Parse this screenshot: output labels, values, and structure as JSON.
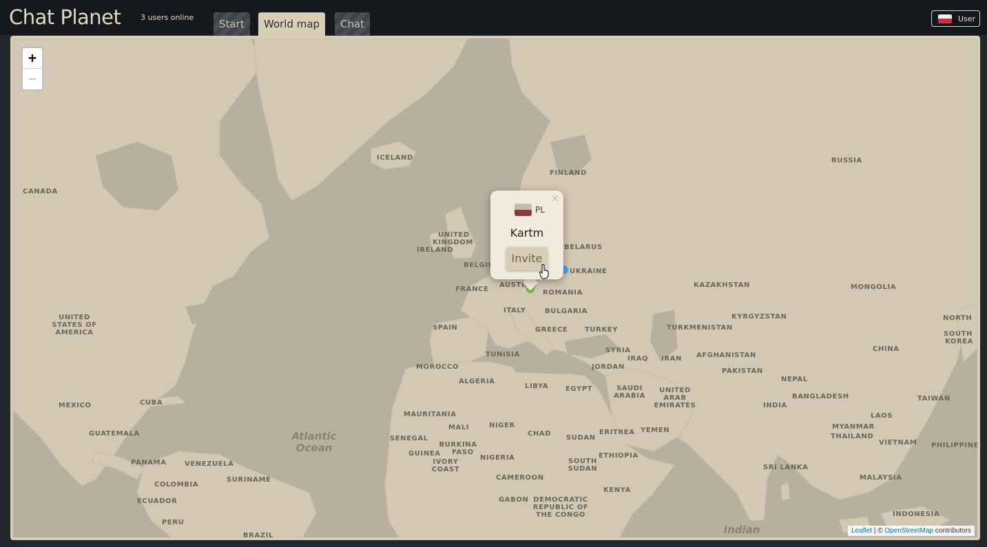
{
  "app": {
    "title": "Chat Planet",
    "online_status": "3 users online"
  },
  "tabs": [
    {
      "label": "Start",
      "active": false
    },
    {
      "label": "World map",
      "active": true
    },
    {
      "label": "Chat",
      "active": false
    }
  ],
  "user_button": {
    "label": "User",
    "flag_icon": "poland-flag-icon"
  },
  "map": {
    "zoom_in": "+",
    "zoom_out": "−",
    "labels": [
      "ICELAND",
      "FINLAND",
      "RUSSIA",
      "CANADA",
      "UNITED",
      "KINGDOM",
      "IRELAND",
      "BELGIUM",
      "BELARUS",
      "UKRAINE",
      "FRANCE",
      "AUSTRIA",
      "ROMANIA",
      "KAZAKHSTAN",
      "MONGOLIA",
      "ITALY",
      "BULGARIA",
      "SPAIN",
      "GREECE",
      "TURKEY",
      "KYRGYZSTAN",
      "TURKMENISTAN",
      "NORTH",
      "SOUTH",
      "KOREA",
      "UNITED",
      "STATES OF",
      "AMERICA",
      "TUNISIA",
      "SYRIA",
      "IRAQ",
      "IRAN",
      "AFGHANISTAN",
      "CHINA",
      "MOROCCO",
      "JORDAN",
      "PAKISTAN",
      "ALGERIA",
      "LIBYA",
      "EGYPT",
      "SAUDI",
      "ARABIA",
      "NEPAL",
      "UNITED",
      "ARAB",
      "EMIRATES",
      "BANGLADESH",
      "MEXICO",
      "CUBA",
      "INDIA",
      "TAIWAN",
      "MAURITANIA",
      "MALI",
      "NIGER",
      "ERITREA",
      "YEMEN",
      "LAOS",
      "GUATEMALA",
      "SENEGAL",
      "BURKINA",
      "FASO",
      "CHAD",
      "SUDAN",
      "MYANMAR",
      "THAILAND",
      "VIETNAM",
      "PHILIPPINES",
      "GUINEA",
      "IVORY",
      "COAST",
      "NIGERIA",
      "ETHIOPIA",
      "PANAMA",
      "VENEZUELA",
      "SOUTH",
      "SUDAN",
      "SRI LANKA",
      "CAMEROON",
      "SURINAME",
      "COLOMBIA",
      "MALAYSIA",
      "KENYA",
      "GABON",
      "DEMOCRATIC",
      "REPUBLIC OF",
      "THE CONGO",
      "ECUADOR",
      "PERU",
      "INDONESIA",
      "BRAZIL"
    ],
    "oceans": {
      "atlantic": [
        "Atlantic",
        "Ocean"
      ],
      "indian": "Indian"
    },
    "attribution": {
      "leaflet": "Leaflet",
      "separator": " | © ",
      "osm": "OpenStreetMap",
      "suffix": " contributors"
    }
  },
  "popup": {
    "country_code": "PL",
    "username": "Kartm",
    "invite_label": "Invite",
    "close": "×"
  },
  "colors": {
    "sea": "#b8af9e",
    "land": "#d3c8b3",
    "accent": "#d8cdb5",
    "marker_green": "#7bc142",
    "marker_blue": "#4aa3df"
  }
}
